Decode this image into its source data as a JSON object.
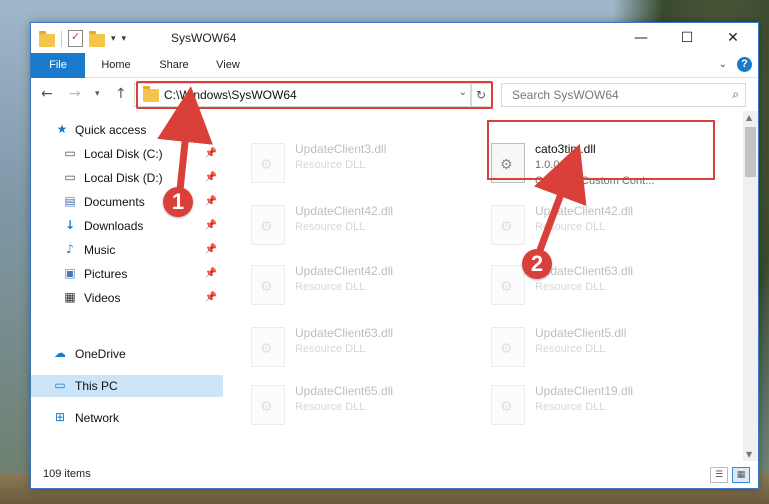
{
  "window": {
    "title": "SysWOW64",
    "controls": {
      "minimize": "—",
      "maximize": "☐",
      "close": "✕"
    }
  },
  "ribbon": {
    "tabs": [
      "File",
      "Home",
      "Share",
      "View"
    ],
    "help": "?"
  },
  "navigation": {
    "address": "C:\\Windows\\SysWOW64",
    "search_placeholder": "Search SysWOW64"
  },
  "sidebar": {
    "items": [
      {
        "label": "Quick access",
        "icon": "star-icon",
        "pinned": false
      },
      {
        "label": "Local Disk (C:)",
        "icon": "drive-icon",
        "pinned": true
      },
      {
        "label": "Local Disk (D:)",
        "icon": "drive-icon",
        "pinned": true
      },
      {
        "label": "Documents",
        "icon": "document-icon",
        "pinned": true
      },
      {
        "label": "Downloads",
        "icon": "download-icon",
        "pinned": true
      },
      {
        "label": "Music",
        "icon": "music-icon",
        "pinned": true
      },
      {
        "label": "Pictures",
        "icon": "pictures-icon",
        "pinned": true
      },
      {
        "label": "Videos",
        "icon": "videos-icon",
        "pinned": true
      },
      {
        "label": "OneDrive",
        "icon": "cloud-icon",
        "pinned": false
      },
      {
        "label": "This PC",
        "icon": "computer-icon",
        "pinned": false,
        "selected": true
      },
      {
        "label": "Network",
        "icon": "network-icon",
        "pinned": false
      }
    ]
  },
  "files": {
    "highlighted": {
      "name": "cato3tim.dll",
      "version": "1.0.0.0",
      "description": "CA-Time Custom Cont..."
    },
    "left_column": [
      {
        "name": "UpdateClient3.dll",
        "type": "Resource DLL"
      },
      {
        "name": "UpdateClient42.dll",
        "type": "Resource DLL"
      },
      {
        "name": "UpdateClient42.dll",
        "type": "Resource DLL"
      },
      {
        "name": "UpdateClient63.dll",
        "type": "Resource DLL"
      },
      {
        "name": "UpdateClient65.dll",
        "type": "Resource DLL"
      }
    ],
    "right_column": [
      {
        "name": "UpdateClient42.dll",
        "type": "Resource DLL"
      },
      {
        "name": "UpdateClient63.dll",
        "type": "Resource DLL"
      },
      {
        "name": "UpdateClient5.dll",
        "type": "Resource DLL"
      },
      {
        "name": "UpdateClient19.dll",
        "type": "Resource DLL"
      }
    ]
  },
  "status": {
    "item_count": "109 items"
  },
  "callouts": [
    "1",
    "2"
  ],
  "colors": {
    "accent": "#1979ca",
    "highlight": "#d9403a",
    "selection": "#cce4f7"
  }
}
